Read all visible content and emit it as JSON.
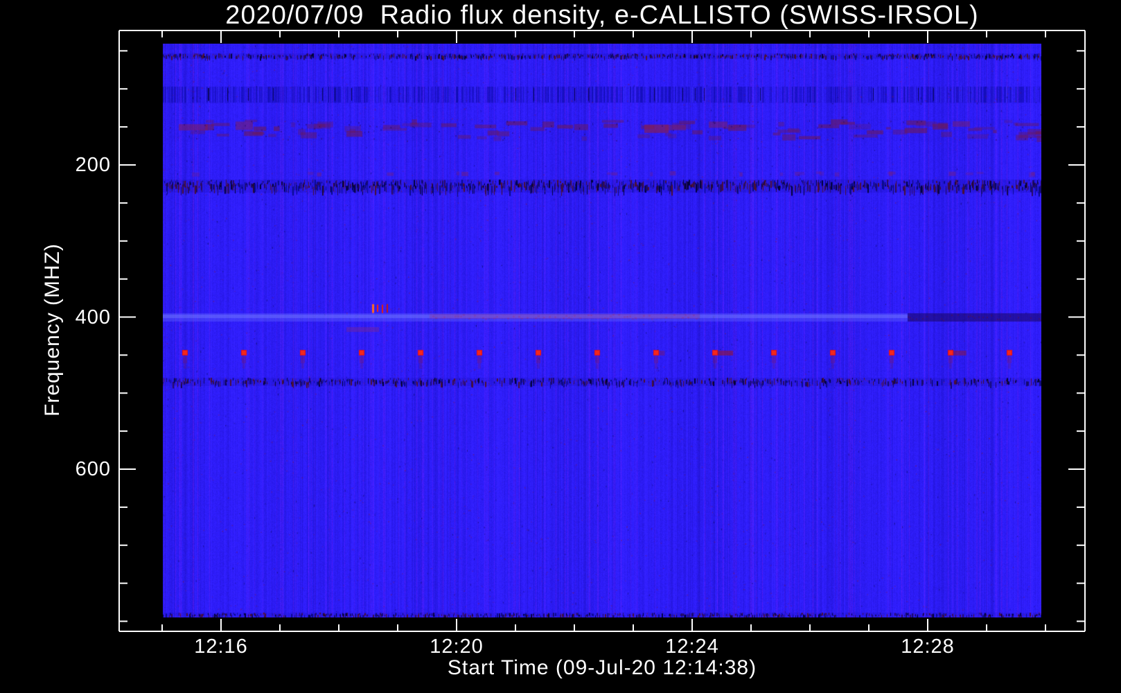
{
  "page": {
    "background": "#000000",
    "foreground": "#ffffff"
  },
  "chart_data": {
    "type": "heatmap",
    "title": "2020/07/09  Radio flux density, e-CALLISTO (SWISS-IRSOL)",
    "xlabel": "Start Time (09-Jul-20 12:14:38)",
    "ylabel": "Frequency (MHZ)",
    "x_axis": {
      "start_time": "12:14:38",
      "tick_labels": [
        "12:16",
        "12:20",
        "12:24",
        "12:28"
      ],
      "major_tick_minutes": [
        16,
        20,
        24,
        28
      ],
      "minor_tick_minutes": [
        15,
        17,
        18,
        19,
        21,
        22,
        23,
        25,
        26,
        27,
        29,
        30
      ]
    },
    "y_axis": {
      "units": "MHZ",
      "inverted": true,
      "tick_labels": [
        "200",
        "400",
        "600"
      ],
      "major_tick_mhz": [
        200,
        400,
        600
      ],
      "minor_tick_mhz": [
        50,
        100,
        150,
        250,
        300,
        350,
        450,
        500,
        550,
        650,
        700,
        750,
        800
      ],
      "visible_range_mhz": [
        40,
        795
      ]
    },
    "colors": {
      "background": "#000000",
      "axis": "#ffffff",
      "base_blue": "#2014f5",
      "stripe_dark": "#1410c8",
      "stripe_light": "#3030ff",
      "purple_tint": "#46189c",
      "band_dark": "#05054a",
      "speckle_navy": "#0a0a8e",
      "speckle_maroon": "#5a1440",
      "quiet_band_blue": "#4b48ff",
      "marker_red": "#e51111",
      "burst_orange": "#ff4a10"
    },
    "features": {
      "calibration_markers": {
        "freq_mhz": 446.5,
        "interval_seconds": 60,
        "times_min": [
          15.39,
          16.39,
          17.39,
          18.39,
          19.39,
          20.39,
          21.39,
          22.39,
          23.39,
          24.39,
          25.39,
          26.39,
          27.39,
          28.39,
          29.39
        ],
        "smears": [
          {
            "t": 23.39,
            "len": 0.1,
            "alpha": 0.35
          },
          {
            "t": 24.39,
            "len": 0.26,
            "alpha": 0.6
          },
          {
            "t": 28.39,
            "len": 0.22,
            "alpha": 0.5
          }
        ]
      },
      "quiet_band": {
        "freq_mhz": [
          395,
          406
        ],
        "time_min": [
          15.01,
          27.66
        ]
      },
      "dark_segment": {
        "freq_mhz": [
          395,
          406
        ],
        "time_min": [
          27.66,
          29.93
        ]
      },
      "red_burst_dashes": {
        "freq_mhz": [
          382,
          395
        ],
        "times_min": [
          18.565,
          18.65,
          18.735,
          18.81
        ]
      },
      "faint_red_drift": {
        "freq_mhz": [
          396,
          402
        ],
        "time_min": [
          19.54,
          24.13
        ]
      },
      "purple_patch": {
        "freq_mhz": [
          413,
          420
        ],
        "time_min": [
          18.13,
          18.68
        ]
      },
      "rfi_bands_mhz": {
        "top_edge": [
          40.5,
          47
        ],
        "band_55": [
          53,
          60
        ],
        "fm_band": [
          97,
          118
        ],
        "smudge_rows": [
          140,
          168
        ],
        "dot_row": [
          208,
          214
        ],
        "dense_band_227": [
          219.5,
          235.5
        ],
        "dense_band_485": [
          480,
          490
        ],
        "bottom_edge": [
          789,
          795
        ]
      }
    }
  }
}
